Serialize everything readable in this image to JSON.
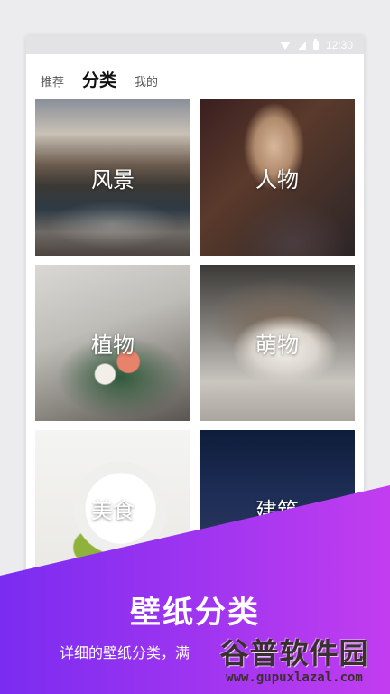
{
  "status_bar": {
    "time": "12:30"
  },
  "tabs": [
    {
      "label": "推荐",
      "active": false
    },
    {
      "label": "分类",
      "active": true
    },
    {
      "label": "我的",
      "active": false
    }
  ],
  "categories": [
    {
      "label": "风景"
    },
    {
      "label": "人物"
    },
    {
      "label": "植物"
    },
    {
      "label": "萌物"
    },
    {
      "label": "美食"
    },
    {
      "label": "建筑"
    }
  ],
  "promo": {
    "title": "壁纸分类",
    "subtitle": "详细的壁纸分类，满"
  },
  "watermark": {
    "title": "谷普软件园",
    "url": "www.gupuxlazal.com"
  },
  "colors": {
    "promo_gradient_start": "#7a2cf0",
    "promo_gradient_end": "#c23df0",
    "page_bg": "#ececef"
  }
}
